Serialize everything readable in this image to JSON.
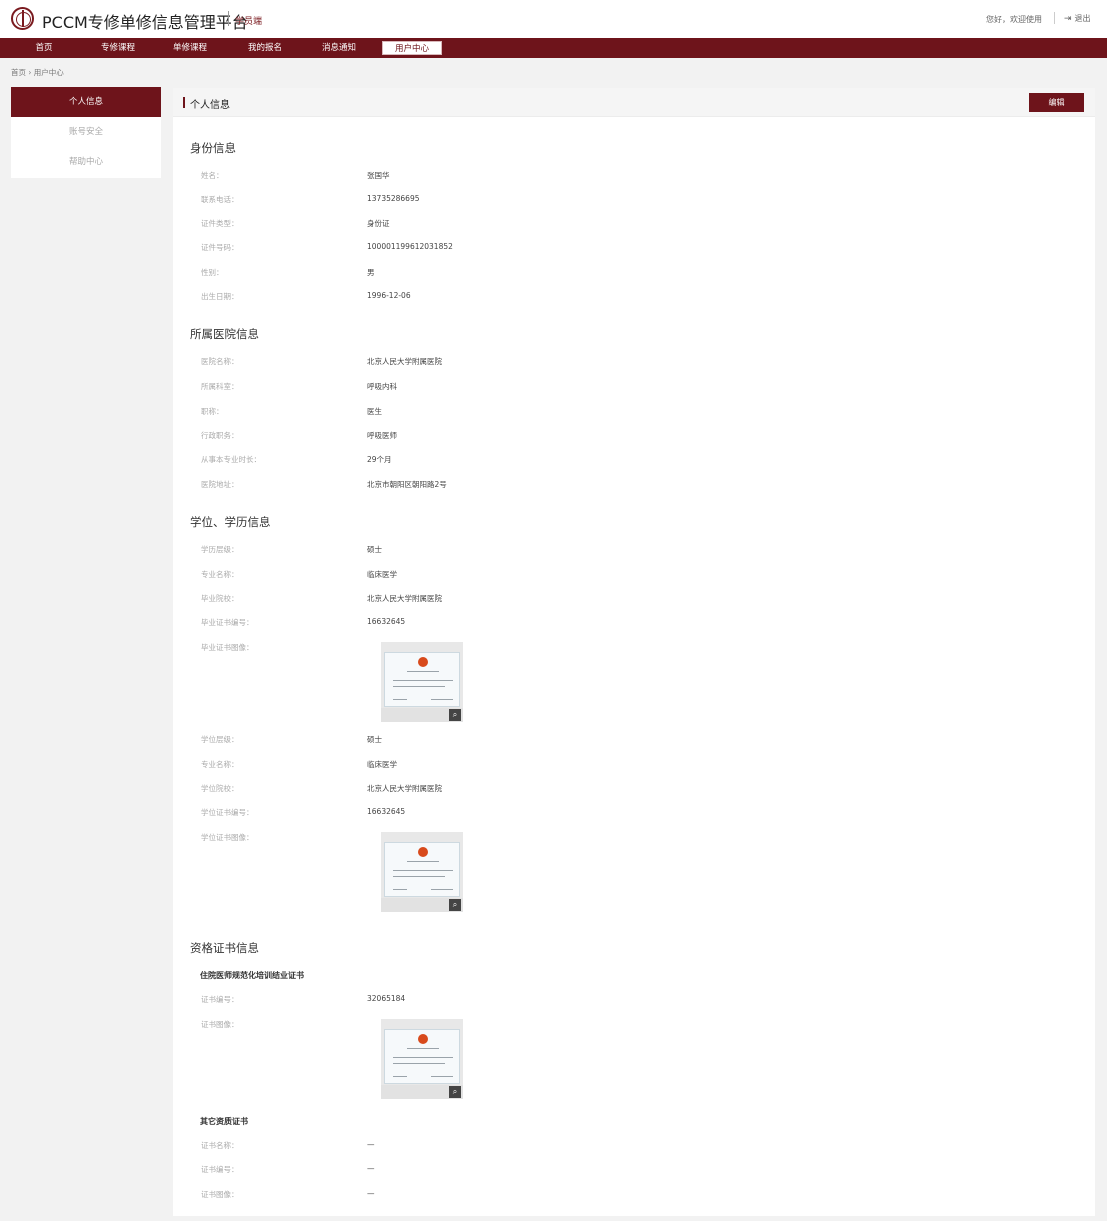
{
  "header": {
    "brand": "PCCM专修单修信息管理平台",
    "brand_sub": "学员端",
    "greeting": "您好，欢迎使用",
    "logout": "退出"
  },
  "nav": {
    "items": [
      {
        "label": "首页"
      },
      {
        "label": "专修课程"
      },
      {
        "label": "单修课程"
      },
      {
        "label": "我的报名"
      },
      {
        "label": "消息通知"
      },
      {
        "label": "用户中心"
      }
    ]
  },
  "breadcrumb": "首页 › 用户中心",
  "sidebar": {
    "items": [
      {
        "label": "个人信息"
      },
      {
        "label": "账号安全"
      },
      {
        "label": "帮助中心"
      }
    ]
  },
  "main": {
    "title": "个人信息",
    "edit_label": "编辑",
    "identity": {
      "title": "身份信息",
      "fields": [
        {
          "label": "姓名：",
          "value": "张国华"
        },
        {
          "label": "联系电话：",
          "value": "13735286695"
        },
        {
          "label": "证件类型：",
          "value": "身份证"
        },
        {
          "label": "证件号码：",
          "value": "100001199612031852"
        },
        {
          "label": "性别：",
          "value": "男"
        },
        {
          "label": "出生日期：",
          "value": "1996-12-06"
        }
      ]
    },
    "hospital": {
      "title": "所属医院信息",
      "fields": [
        {
          "label": "医院名称：",
          "value": "北京人民大学附属医院"
        },
        {
          "label": "所属科室：",
          "value": "呼吸内科"
        },
        {
          "label": "职称：",
          "value": "医生"
        },
        {
          "label": "行政职务：",
          "value": "呼吸医师"
        },
        {
          "label": "从事本专业时长：",
          "value": "29个月"
        },
        {
          "label": "医院地址：",
          "value": "北京市朝阳区朝阳路2号"
        }
      ]
    },
    "education": {
      "title": "学位、学历信息",
      "degree_fields": [
        {
          "label": "学历层级：",
          "value": "硕士"
        },
        {
          "label": "专业名称：",
          "value": "临床医学"
        },
        {
          "label": "毕业院校：",
          "value": "北京人民大学附属医院"
        },
        {
          "label": "毕业证书编号：",
          "value": "16632645"
        },
        {
          "label": "毕业证书图像：",
          "value": ""
        }
      ],
      "degree2_fields": [
        {
          "label": "学位层级：",
          "value": "硕士"
        },
        {
          "label": "专业名称：",
          "value": "临床医学"
        },
        {
          "label": "学位院校：",
          "value": "北京人民大学附属医院"
        },
        {
          "label": "学位证书编号：",
          "value": "16632645"
        },
        {
          "label": "学位证书图像：",
          "value": ""
        }
      ]
    },
    "qualification": {
      "title": "资格证书信息",
      "sub1": "住院医师规范化培训结业证书",
      "cert_fields": [
        {
          "label": "证书编号：",
          "value": "32065184"
        },
        {
          "label": "证书图像：",
          "value": ""
        }
      ],
      "sub2": "其它资质证书",
      "other_fields": [
        {
          "label": "证书名称：",
          "value": "—"
        },
        {
          "label": "证书编号：",
          "value": "—"
        },
        {
          "label": "证书图像：",
          "value": "—"
        }
      ]
    }
  },
  "colors": {
    "brand": "#6e141b",
    "background": "#f2f2f2",
    "panel": "#ffffff"
  },
  "icons": {
    "logo": "hospital-logo-icon",
    "logout": "logout-icon",
    "zoom": "magnifier-icon"
  }
}
